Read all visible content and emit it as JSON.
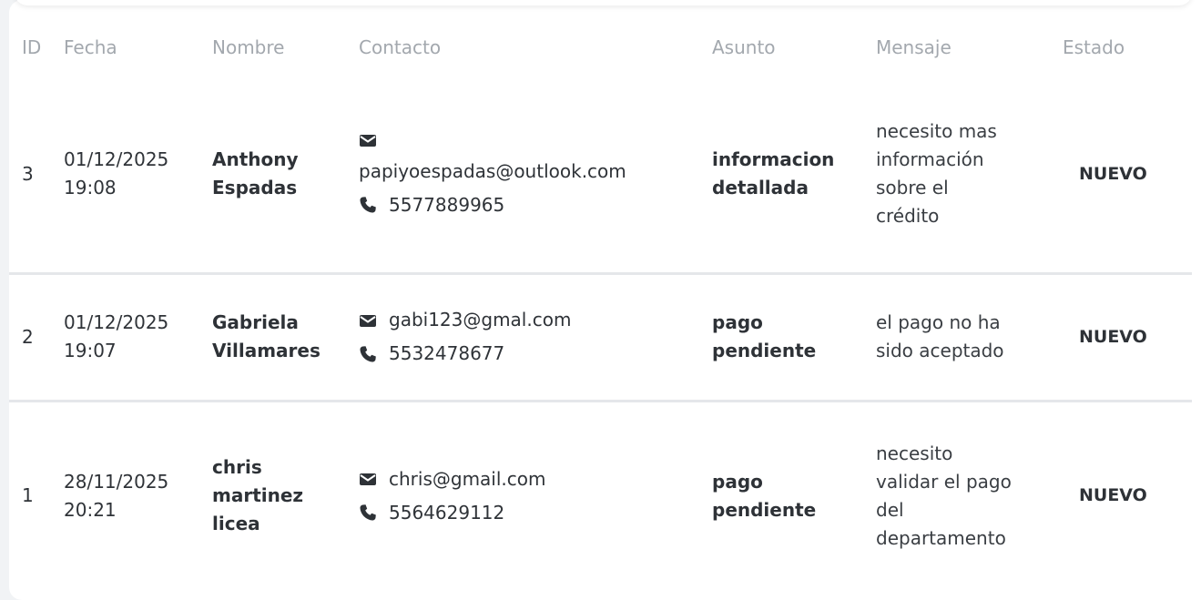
{
  "columns": [
    "ID",
    "Fecha",
    "Nombre",
    "Contacto",
    "Asunto",
    "Mensaje",
    "Estado"
  ],
  "rows": [
    {
      "id": "3",
      "date": "01/12/2025",
      "time": "19:08",
      "name_line1": "Anthony",
      "name_line2": "Espadas",
      "name_line3": "",
      "email": "papiyoespadas@outlook.com",
      "phone": "5577889965",
      "subject_line1": "informacion",
      "subject_line2": "detallada",
      "message_lines": [
        "necesito mas",
        "información",
        "sobre el",
        "crédito"
      ],
      "status": "NUEVO"
    },
    {
      "id": "2",
      "date": "01/12/2025",
      "time": "19:07",
      "name_line1": "Gabriela",
      "name_line2": "Villamares",
      "name_line3": "",
      "email": "gabi123@gmal.com",
      "phone": "5532478677",
      "subject_line1": "pago",
      "subject_line2": "pendiente",
      "message_lines": [
        "el pago no ha",
        "sido aceptado"
      ],
      "status": "NUEVO"
    },
    {
      "id": "1",
      "date": "28/11/2025",
      "time": "20:21",
      "name_line1": "chris",
      "name_line2": "martinez",
      "name_line3": "licea",
      "email": "chris@gmail.com",
      "phone": "5564629112",
      "subject_line1": "pago",
      "subject_line2": "pendiente",
      "message_lines": [
        "necesito",
        "validar el pago",
        "del",
        "departamento"
      ],
      "status": "NUEVO"
    }
  ],
  "icons": {
    "email": "envelope-icon",
    "phone": "phone-icon"
  },
  "colors": {
    "text": "#2f3338",
    "header": "#a3a8ae",
    "divider": "#e5e7ea"
  }
}
